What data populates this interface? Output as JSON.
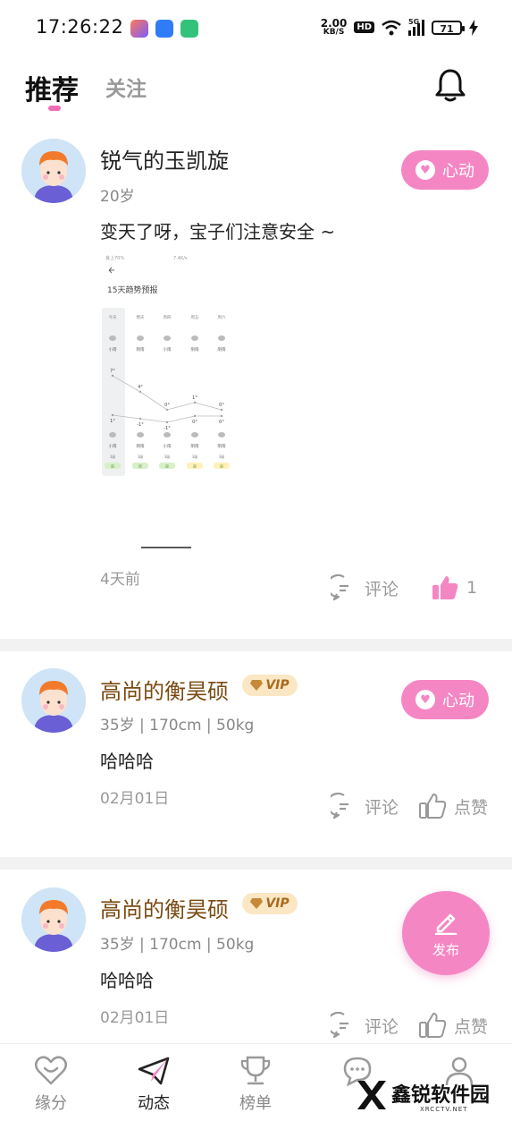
{
  "status_bar": {
    "time": "17:26:22",
    "net_speed_value": "2.00",
    "net_speed_unit": "KB/S",
    "hd_badge": "HD",
    "network": "5G",
    "battery": "71"
  },
  "header": {
    "tabs": [
      {
        "label": "推荐",
        "active": true
      },
      {
        "label": "关注",
        "active": false
      }
    ],
    "bell_icon": "bell-icon"
  },
  "posts": [
    {
      "username": "锐气的玉凯旋",
      "vip": false,
      "meta": "20岁",
      "content": "变天了呀，宝子们注意安全 ~",
      "has_image": true,
      "time": "4天前",
      "like_label": "心动",
      "comment_label": "评论",
      "thumb_label": "1",
      "thumb_active": true
    },
    {
      "username": "高尚的衡昊硕",
      "vip": true,
      "vip_label": "VIP",
      "meta": "35岁 | 170cm | 50kg",
      "content": "哈哈哈",
      "time": "02月01日",
      "like_label": "心动",
      "comment_label": "评论",
      "thumb_label": "点赞",
      "thumb_active": false
    },
    {
      "username": "高尚的衡昊硕",
      "vip": true,
      "vip_label": "VIP",
      "meta": "35岁 | 170cm | 50kg",
      "content": "哈哈哈",
      "time": "02月01日",
      "comment_label": "评论",
      "thumb_label": "点赞",
      "thumb_active": false
    }
  ],
  "embedded_image": {
    "title": "15天趋势预报",
    "header_left": "良上70%",
    "header_right": "7.4K/s",
    "days": [
      "今天",
      "明天",
      "周四",
      "周五",
      "周六"
    ],
    "day_weather": [
      "小雨",
      "阴雨",
      "小雨",
      "阴雨",
      "阴雨"
    ],
    "high_temps": [
      "7°",
      "4°",
      "0°",
      "1°",
      "0°"
    ],
    "low_temps": [
      "1°",
      "-1°",
      "-1°",
      "0°",
      "0°"
    ],
    "night_weather": [
      "小雨",
      "阴雨",
      "小雨",
      "阴雨",
      "阴雨"
    ],
    "wind": [
      "3级",
      "3级",
      "3级",
      "3级",
      "3级"
    ],
    "aqi": [
      "良",
      "优",
      "良",
      "良",
      "良"
    ]
  },
  "fab": {
    "label": "发布"
  },
  "bottom_nav": [
    {
      "label": "缘分",
      "icon": "heart-outline-icon",
      "active": false
    },
    {
      "label": "动态",
      "icon": "paper-plane-icon",
      "active": true
    },
    {
      "label": "榜单",
      "icon": "trophy-icon",
      "active": false
    },
    {
      "label": "",
      "icon": "chat-icon",
      "active": false
    },
    {
      "label": "",
      "icon": "person-icon",
      "active": false
    }
  ],
  "watermark": {
    "text": "鑫锐软件园",
    "sub": "XRCCTV.NET"
  },
  "colors": {
    "accent": "#f586c4",
    "indicator": "#f06fb3",
    "vip_bg": "#fbe7c4",
    "vip_text": "#a86a1e"
  }
}
